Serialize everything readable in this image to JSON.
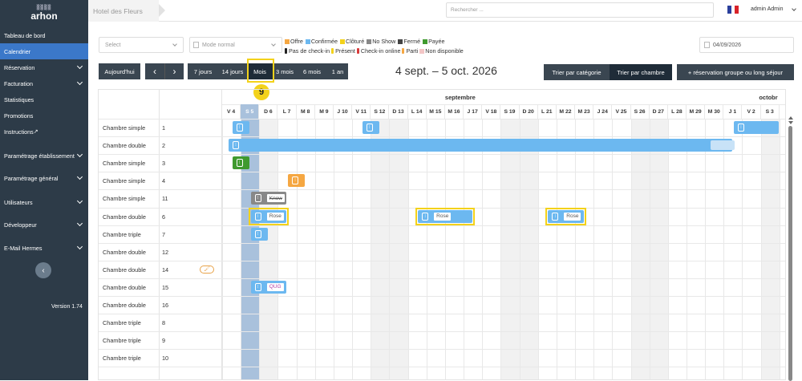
{
  "sidebar": {
    "logo_top": "▒▒▒▒",
    "logo": "arhon",
    "items": [
      {
        "label": "Tableau de bord",
        "chevron": false
      },
      {
        "label": "Calendrier",
        "chevron": false,
        "active": true
      },
      {
        "label": "Réservation",
        "chevron": true
      },
      {
        "label": "Facturation",
        "chevron": true
      },
      {
        "label": "Statistiques",
        "chevron": false
      },
      {
        "label": "Promotions",
        "chevron": false
      },
      {
        "label": "Instructions",
        "chevron": false
      },
      {
        "label": "Paramétrage établissement",
        "chevron": true
      },
      {
        "label": "Paramétrage général",
        "chevron": true
      },
      {
        "label": "Utilisateurs",
        "chevron": true
      },
      {
        "label": "Développeur",
        "chevron": true
      },
      {
        "label": "E-Mail Hermes",
        "chevron": true
      }
    ],
    "version": "Version 1.74"
  },
  "topbar": {
    "hotel": "Hotel des Fleurs",
    "search_placeholder": "Rechercher ...",
    "user": "admin Admin"
  },
  "filters": {
    "select_placeholder": "Select",
    "mode": "Mode normal",
    "date": "04/09/2026"
  },
  "legend": {
    "statuses": [
      {
        "label": "Offre",
        "color": "#f5a742"
      },
      {
        "label": "Confirmée",
        "color": "#6cb8f0"
      },
      {
        "label": "Clôturé",
        "color": "#f3d21b"
      },
      {
        "label": "No Show",
        "color": "#888888"
      },
      {
        "label": "Fermé",
        "color": "#444444"
      },
      {
        "label": "Payée",
        "color": "#3f9a2e"
      }
    ],
    "presence": [
      {
        "label": "Pas de check-in",
        "color": "#222222"
      },
      {
        "label": "Présent",
        "color": "#f3d21b"
      },
      {
        "label": "Check-in online",
        "color": "#d83a3a"
      },
      {
        "label": "Parti",
        "color": "#f5a742"
      },
      {
        "label": "Non disponible",
        "color": "#f3c6c6"
      }
    ]
  },
  "toolbar": {
    "today": "Aujourd'hui",
    "prev": "‹",
    "next": "›",
    "views": [
      "7 jours",
      "14 jours",
      "Mois",
      "3 mois",
      "6 mois",
      "1 an"
    ],
    "active_view": "Mois",
    "range": "4 sept. – 5 oct. 2026",
    "sort_category": "Trier par catégorie",
    "sort_room": "Trier par chambre",
    "group_btn": "+ réservation groupe ou long séjour",
    "step_badge": "9"
  },
  "calendar": {
    "months": [
      {
        "label": "septembre"
      },
      {
        "label": "octobr"
      }
    ],
    "days": [
      "V 4",
      "S 5",
      "D 6",
      "L 7",
      "M 8",
      "M 9",
      "J 10",
      "V 11",
      "S 12",
      "D 13",
      "L 14",
      "M 15",
      "M 16",
      "J 17",
      "V 18",
      "S 19",
      "D 20",
      "L 21",
      "M 22",
      "M 23",
      "J 24",
      "V 25",
      "S 26",
      "D 27",
      "L 28",
      "M 29",
      "M 30",
      "J 1",
      "V 2",
      "S 3"
    ],
    "today_index": 1,
    "weekend_indices": [
      1,
      2,
      8,
      9,
      15,
      16,
      22,
      23,
      29
    ],
    "rooms": [
      {
        "type": "Chambre simple",
        "num": "1"
      },
      {
        "type": "Chambre double",
        "num": "2"
      },
      {
        "type": "Chambre simple",
        "num": "3"
      },
      {
        "type": "Chambre simple",
        "num": "4"
      },
      {
        "type": "Chambre simple",
        "num": "11"
      },
      {
        "type": "Chambre double",
        "num": "6"
      },
      {
        "type": "Chambre triple",
        "num": "7"
      },
      {
        "type": "Chambre double",
        "num": "12"
      },
      {
        "type": "Chambre double",
        "num": "14"
      },
      {
        "type": "Chambre double",
        "num": "15"
      },
      {
        "type": "Chambre double",
        "num": "16"
      },
      {
        "type": "Chambre triple",
        "num": "8"
      },
      {
        "type": "Chambre triple",
        "num": "9"
      },
      {
        "type": "Chambre triple",
        "num": "10"
      }
    ],
    "bookings": [
      {
        "row": 0,
        "start": 0.5,
        "end": 1.5,
        "color": "#6cb8f0",
        "icon": true
      },
      {
        "row": 0,
        "start": 7.5,
        "end": 8.5,
        "color": "#6cb8f0",
        "icon": true
      },
      {
        "row": 0,
        "start": 27.5,
        "end": 30,
        "color": "#6cb8f0",
        "icon": true
      },
      {
        "row": 1,
        "start": 0.3,
        "end": 27.5,
        "color": "#6cb8f0",
        "icon": true
      },
      {
        "row": 2,
        "start": 0.5,
        "end": 1.5,
        "color": "#3f9a2e",
        "icon": true
      },
      {
        "row": 3,
        "start": 3.5,
        "end": 4.5,
        "color": "#f5a742",
        "icon": true
      },
      {
        "row": 4,
        "start": 1.5,
        "end": 3.5,
        "color": "#888888",
        "icon": true,
        "tag": "Know",
        "strike": true
      },
      {
        "row": 5,
        "start": 1.5,
        "end": 3.5,
        "color": "#6cb8f0",
        "icon": true,
        "tag": "Rose",
        "hl": true
      },
      {
        "row": 5,
        "start": 10.5,
        "end": 13.5,
        "color": "#6cb8f0",
        "icon": true,
        "tag": "Rose",
        "hl": true
      },
      {
        "row": 5,
        "start": 17.5,
        "end": 19.5,
        "color": "#6cb8f0",
        "icon": true,
        "tag": "Rose",
        "hl": true
      },
      {
        "row": 6,
        "start": 1.5,
        "end": 2.5,
        "color": "#6cb8f0",
        "icon": true
      },
      {
        "row": 9,
        "start": 1.5,
        "end": 3.5,
        "color": "#6cb8f0",
        "icon": true,
        "tag": "QUG",
        "tagcolor": "#b33fa8"
      }
    ],
    "paint_row": 8
  }
}
